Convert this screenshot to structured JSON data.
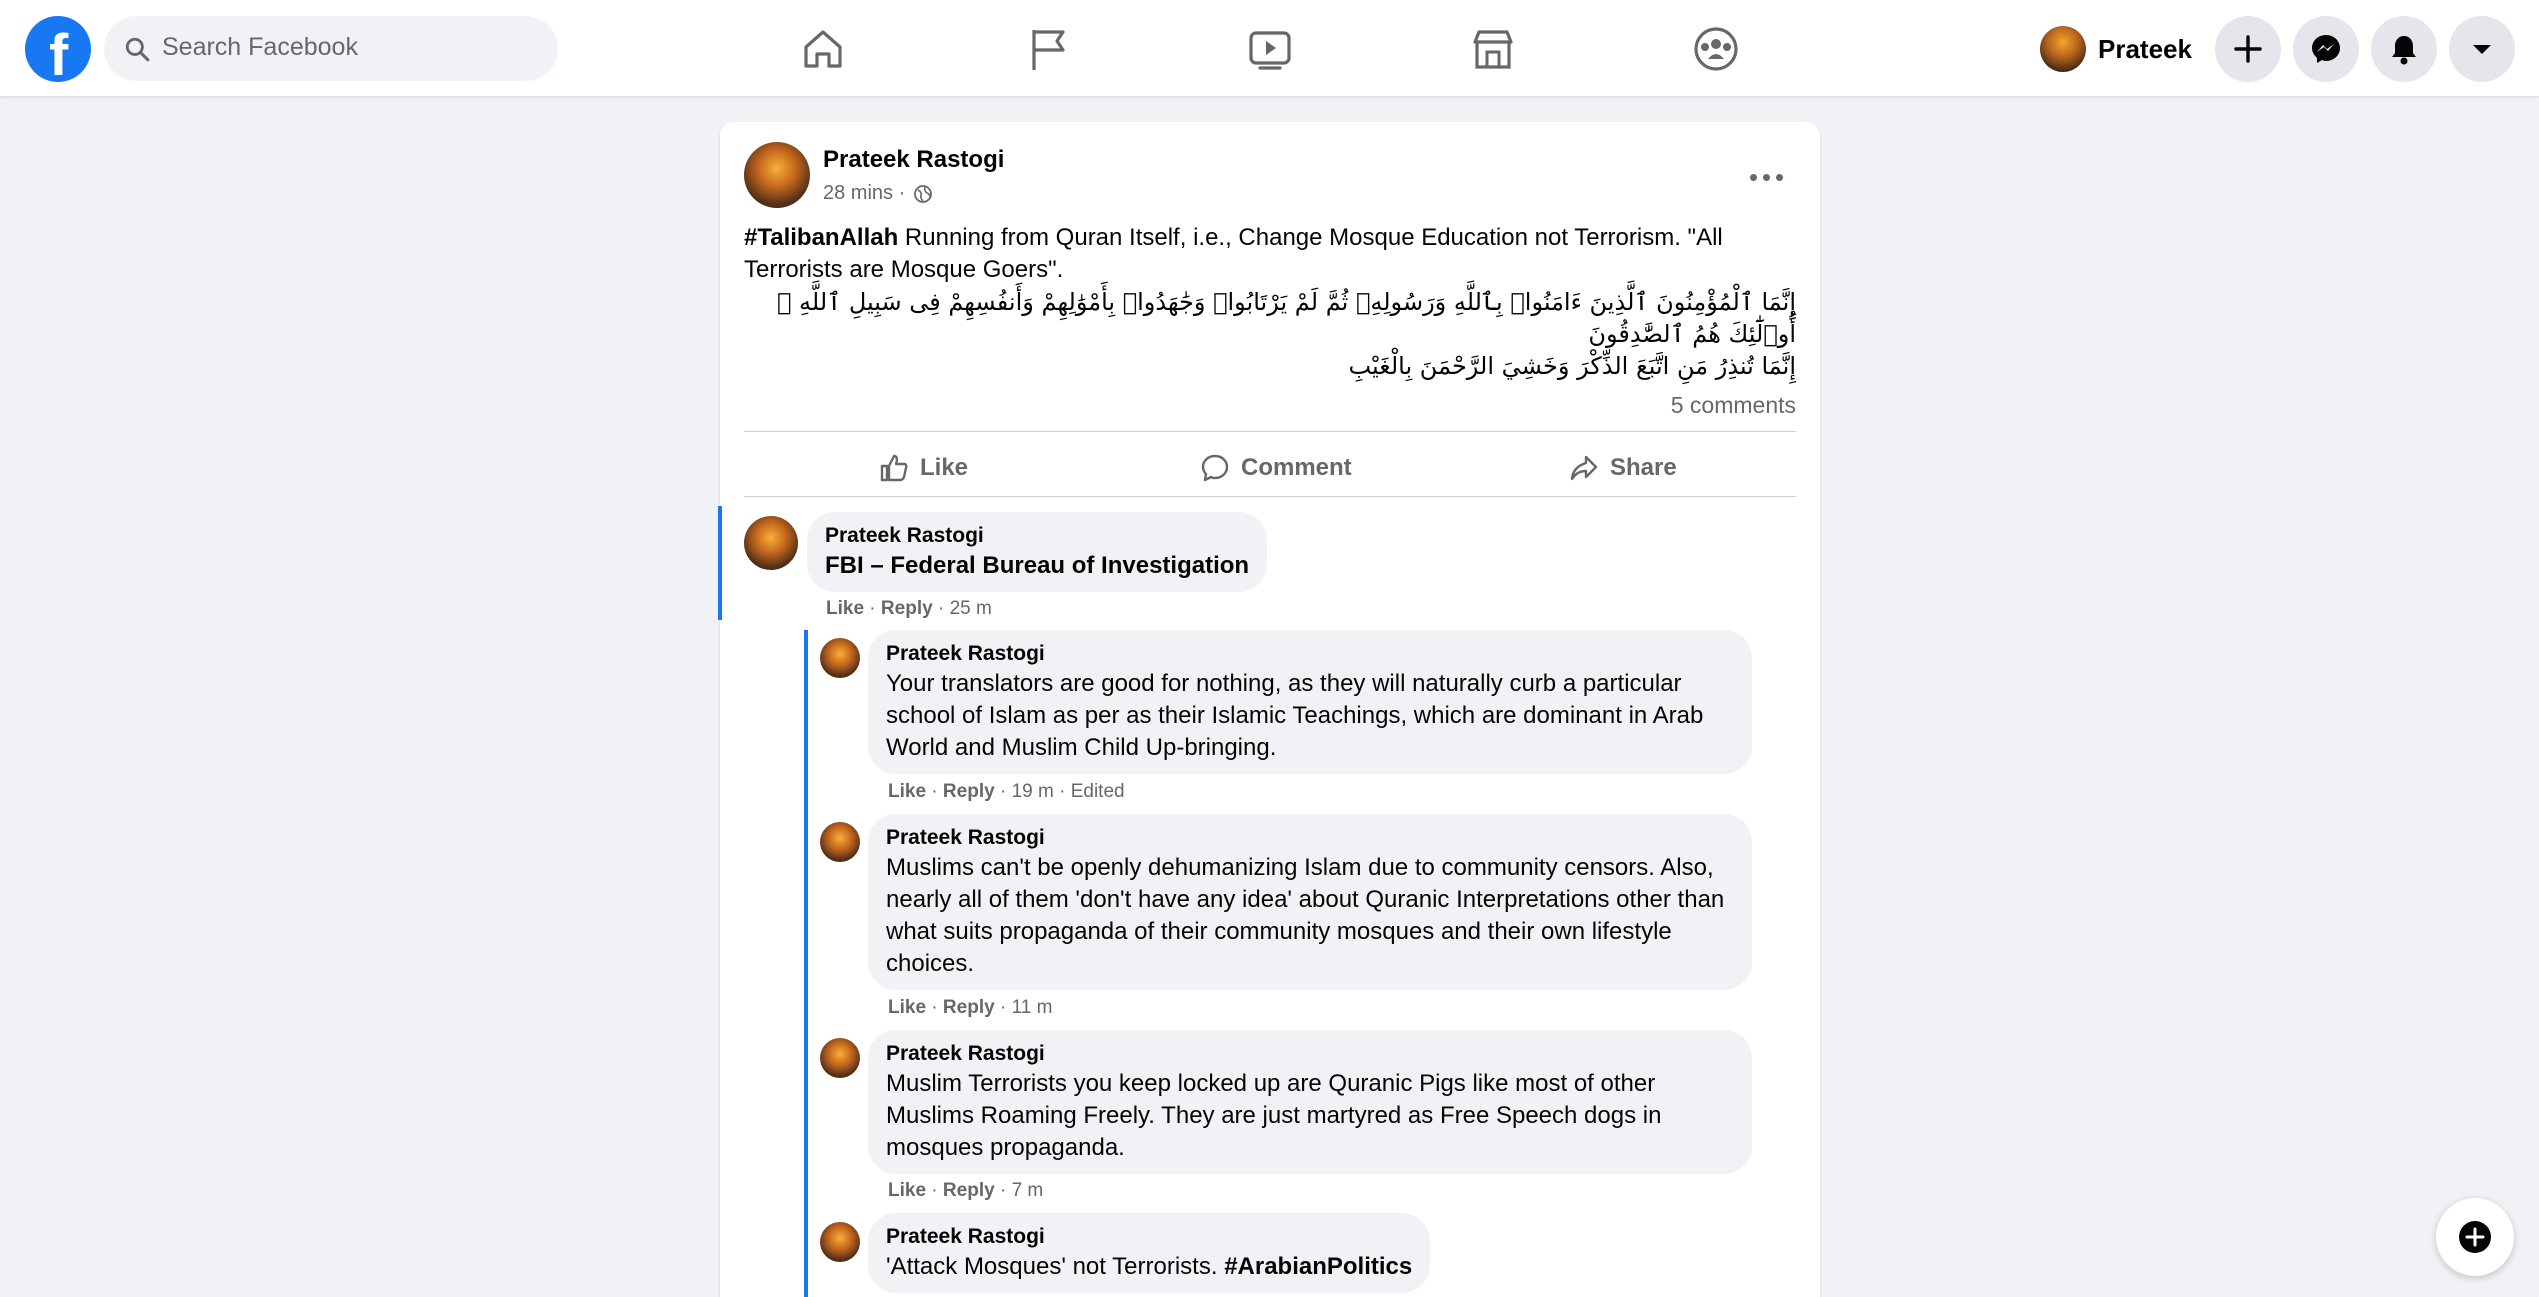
{
  "topbar": {
    "logo": "facebook-logo",
    "search_placeholder": "Search Facebook",
    "nav": [
      "home-icon",
      "pages-flag-icon",
      "watch-video-icon",
      "marketplace-icon",
      "groups-icon"
    ],
    "profile_name": "Prateek",
    "actions": [
      "create-icon",
      "messenger-icon",
      "notifications-icon",
      "account-menu-icon"
    ]
  },
  "post": {
    "author": "Prateek Rastogi",
    "time": "28 mins",
    "audience": "public-globe-icon",
    "hashtag": "#TalibanAllah",
    "text": " Running from Quran Itself, i.e., Change Mosque Education not Terrorism. \"All Terrorists are Mosque Goers\".",
    "arabic_line1": "إِنَّمَا ٱلْمُؤْمِنُونَ ٱلَّذِينَ ءَامَنُوا۟ بِٱللَّهِ وَرَسُولِهِۦ ثُمَّ لَمْ يَرْتَابُوا۟ وَجَٰهَدُوا۟ بِأَمْوَٰلِهِمْ وَأَنفُسِهِمْ فِى سَبِيلِ ٱللَّهِ ۚ أُو۟لَٰٓئِكَ هُمُ ٱلصَّٰدِقُونَ",
    "arabic_line2": "إِنَّمَا تُنذِرُ مَنِ اتَّبَعَ الذِّكْرَ وَخَشِيَ الرَّحْمَنَ بِالْغَيْبِ",
    "comments_count": "5 comments",
    "like_label": "Like",
    "comment_label": "Comment",
    "share_label": "Share"
  },
  "comments": [
    {
      "name": "Prateek Rastogi",
      "text": "FBI – Federal Bureau of Investigation",
      "like": "Like",
      "reply": "Reply",
      "time": "25 m",
      "edited": ""
    },
    {
      "name": "Prateek Rastogi",
      "text": "Your translators are good for nothing, as they will naturally curb a particular school of Islam as per as their Islamic Teachings, which are dominant in Arab World and Muslim Child Up-bringing.",
      "like": "Like",
      "reply": "Reply",
      "time": "19 m",
      "edited": "Edited"
    },
    {
      "name": "Prateek Rastogi",
      "text": "Muslims can't be openly dehumanizing Islam due to community censors. Also, nearly all of them 'don't have any idea' about Quranic Interpretations other than what suits propaganda of their community mosques and their own lifestyle choices.",
      "like": "Like",
      "reply": "Reply",
      "time": "11 m",
      "edited": ""
    },
    {
      "name": "Prateek Rastogi",
      "text": "Muslim Terrorists you keep locked up are Quranic Pigs like most of other Muslims Roaming Freely. They are just martyred as Free Speech dogs in mosques propaganda.",
      "like": "Like",
      "reply": "Reply",
      "time": "7 m",
      "edited": ""
    },
    {
      "name": "Prateek Rastogi",
      "text": "'Attack Mosques' not Terrorists. ",
      "hashtag": "#ArabianPolitics"
    }
  ],
  "colors": {
    "brand": "#1877f2",
    "background": "#f0f2f5",
    "secondary_text": "#65676b"
  }
}
